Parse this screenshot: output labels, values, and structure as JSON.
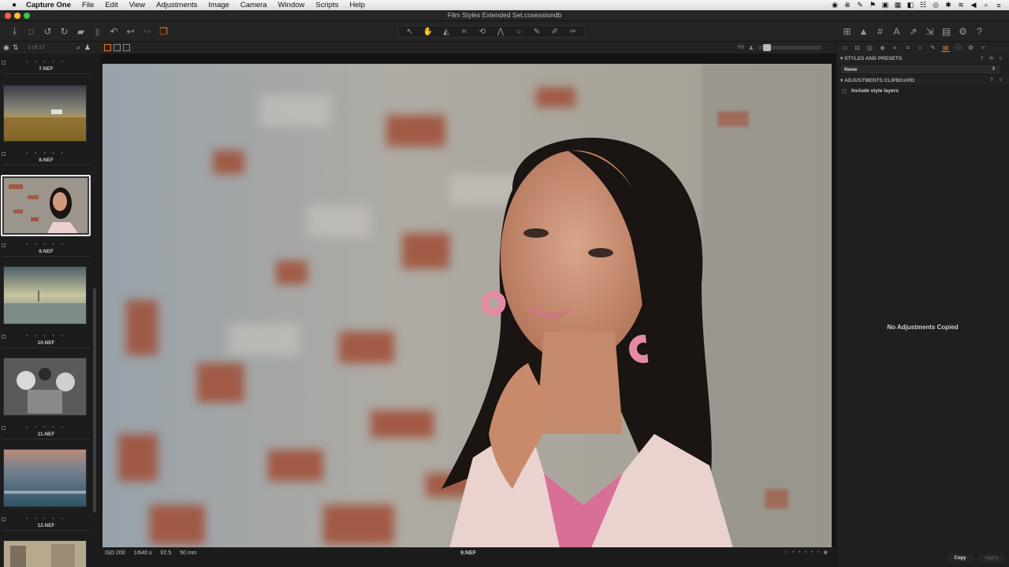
{
  "menubar": {
    "apple": "",
    "items": [
      "Capture One",
      "File",
      "Edit",
      "View",
      "Adjustments",
      "Image",
      "Camera",
      "Window",
      "Scripts",
      "Help"
    ]
  },
  "window": {
    "title": "Film Styles Extended Set.cosessiondb"
  },
  "browser": {
    "counter": "1 of 17",
    "thumbnails": [
      {
        "name": "7.NEF",
        "selected": false
      },
      {
        "name": "8.NEF",
        "selected": false
      },
      {
        "name": "9.NEF",
        "selected": true
      },
      {
        "name": "10.NEF",
        "selected": false
      },
      {
        "name": "11.NEF",
        "selected": false
      },
      {
        "name": "12.NEF",
        "selected": false
      }
    ]
  },
  "viewer": {
    "zoom_label": "Fit",
    "iso": "ISO 200",
    "shutter": "1/640 s",
    "aperture": "f/2.5",
    "focal": "50 mm",
    "filename": "9.NEF"
  },
  "tools": {
    "styles_header": "STYLES AND PRESETS",
    "styles_value": "None",
    "clipboard_header": "ADJUSTMENTS CLIPBOARD",
    "include_label": "Include style layers",
    "empty_message": "No Adjustments Copied",
    "copy_label": "Copy",
    "apply_label": "Apply"
  },
  "colors": {
    "accent": "#e07a2e",
    "background": "#1b1b1b",
    "panel": "#1f1f1f"
  }
}
